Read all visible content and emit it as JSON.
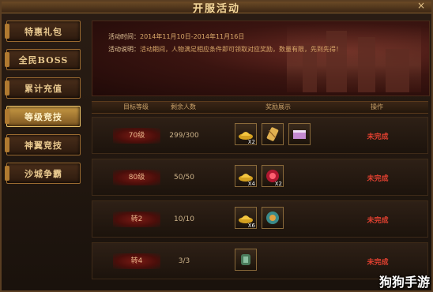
{
  "window": {
    "title": "开服活动",
    "close_icon": "×"
  },
  "sidebar": {
    "items": [
      {
        "label": "特惠礼包",
        "active": false
      },
      {
        "label": "全民BOSS",
        "active": false
      },
      {
        "label": "累计充值",
        "active": false
      },
      {
        "label": "等级竞技",
        "active": true
      },
      {
        "label": "神翼竞技",
        "active": false
      },
      {
        "label": "沙城争霸",
        "active": false
      }
    ]
  },
  "banner": {
    "time_label": "活动时间：",
    "time_value": "2014年11月10日-2014年11月16日",
    "desc_label": "活动说明：",
    "desc_value": "活动期间，人物满足相应条件即可领取对应奖励，数量有限，先到先得！"
  },
  "table": {
    "headers": [
      "目标等级",
      "剩余人数",
      "奖励展示",
      "操作"
    ],
    "rows": [
      {
        "level": "70级",
        "remaining": "299/300",
        "status": "未完成",
        "items": [
          {
            "icon": "gold-ingot-icon",
            "qty": "X2"
          },
          {
            "icon": "scroll-icon",
            "qty": ""
          },
          {
            "icon": "book-icon",
            "qty": ""
          }
        ]
      },
      {
        "level": "80级",
        "remaining": "50/50",
        "status": "未完成",
        "items": [
          {
            "icon": "gold-ingot-icon",
            "qty": "X4"
          },
          {
            "icon": "red-orb-icon",
            "qty": "X2"
          }
        ]
      },
      {
        "level": "转2",
        "remaining": "10/10",
        "status": "未完成",
        "items": [
          {
            "icon": "gold-ingot-icon",
            "qty": "X6"
          },
          {
            "icon": "medal-icon",
            "qty": ""
          }
        ]
      },
      {
        "level": "转4",
        "remaining": "3/3",
        "status": "未完成",
        "items": [
          {
            "icon": "armor-icon",
            "qty": ""
          }
        ]
      }
    ]
  },
  "watermark": "狗狗手游",
  "colors": {
    "accent_gold": "#f0c66a",
    "status_red": "#e04030",
    "level_bg": "#7a1a14"
  }
}
